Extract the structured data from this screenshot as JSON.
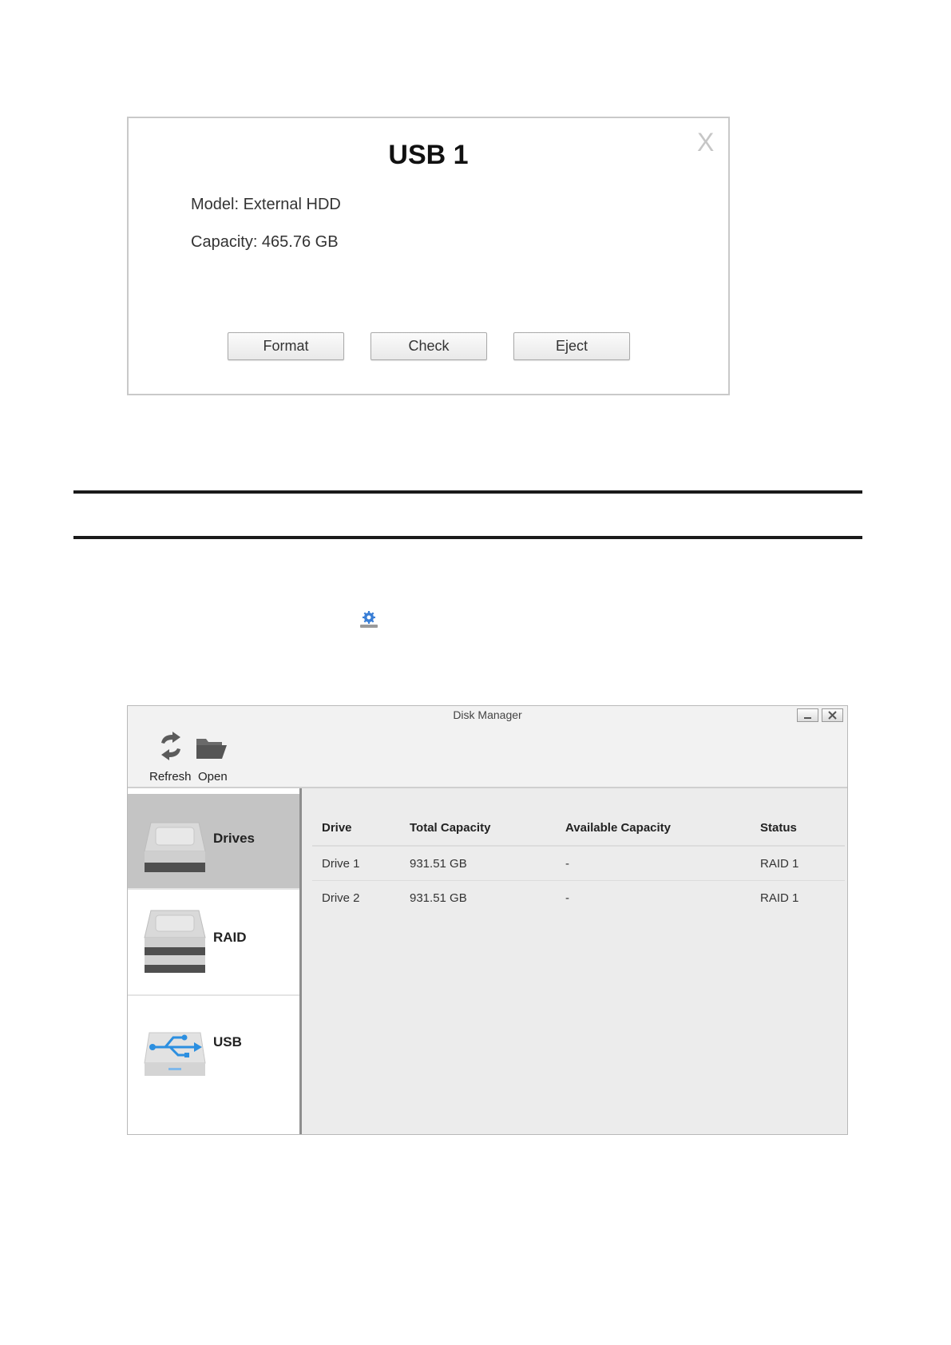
{
  "usb_dialog": {
    "title": "USB 1",
    "close_glyph": "X",
    "model": "Model: External HDD",
    "capacity": "Capacity: 465.76 GB",
    "buttons": {
      "format": "Format",
      "check": "Check",
      "eject": "Eject"
    }
  },
  "disk_manager": {
    "title": "Disk Manager",
    "toolbar": {
      "refresh_label": "Refresh",
      "open_label": "Open"
    },
    "sidebar": {
      "items": [
        {
          "label": "Drives"
        },
        {
          "label": "RAID"
        },
        {
          "label": "USB"
        }
      ]
    },
    "table": {
      "headers": [
        "Drive",
        "Total Capacity",
        "Available Capacity",
        "Status"
      ],
      "rows": [
        [
          "Drive 1",
          "931.51 GB",
          "-",
          "RAID 1"
        ],
        [
          "Drive 2",
          "931.51 GB",
          "-",
          "RAID 1"
        ]
      ]
    }
  },
  "colors": {
    "selected_sidebar": "#c4c4c4",
    "usb_accent": "#2c8fe0",
    "gear_icon": "#3a7fd6"
  },
  "icons": [
    "close-icon",
    "gear-disk-icon",
    "refresh-icon",
    "folder-open-icon",
    "drive-icon",
    "raid-icon",
    "usb-icon",
    "minimize-icon",
    "window-close-icon"
  ]
}
